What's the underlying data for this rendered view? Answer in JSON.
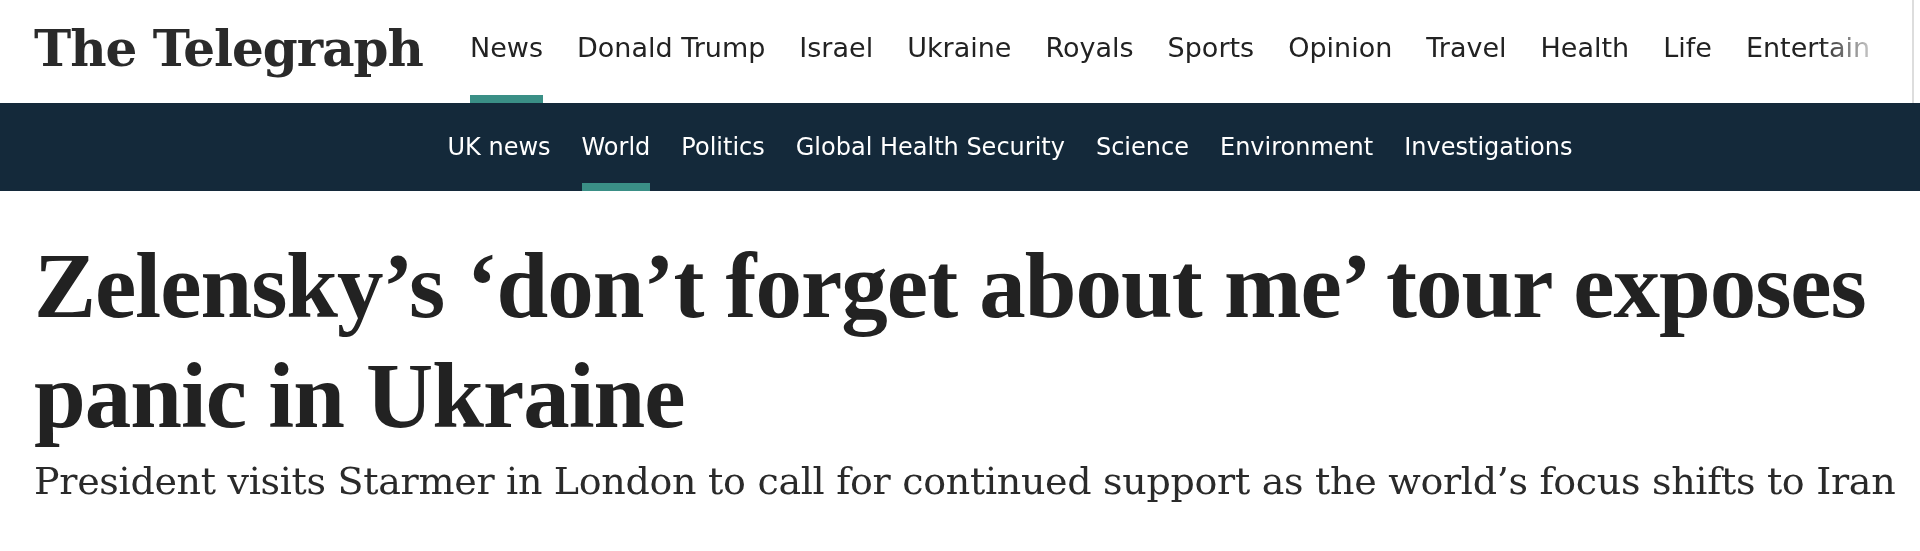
{
  "masthead": {
    "logo": "The Telegraph"
  },
  "primary_nav": [
    {
      "label": "News",
      "selected": true
    },
    {
      "label": "Donald Trump",
      "selected": false
    },
    {
      "label": "Israel",
      "selected": false
    },
    {
      "label": "Ukraine",
      "selected": false
    },
    {
      "label": "Royals",
      "selected": false
    },
    {
      "label": "Sports",
      "selected": false
    },
    {
      "label": "Opinion",
      "selected": false
    },
    {
      "label": "Travel",
      "selected": false
    },
    {
      "label": "Health",
      "selected": false
    },
    {
      "label": "Life",
      "selected": false
    },
    {
      "label": "Entertain",
      "selected": false
    }
  ],
  "secondary_nav": [
    {
      "label": "UK news",
      "selected": false
    },
    {
      "label": "World",
      "selected": true
    },
    {
      "label": "Politics",
      "selected": false
    },
    {
      "label": "Global Health Security",
      "selected": false
    },
    {
      "label": "Science",
      "selected": false
    },
    {
      "label": "Environment",
      "selected": false
    },
    {
      "label": "Investigations",
      "selected": false
    }
  ],
  "article": {
    "headline": "Zelensky’s ‘don’t forget about me’ tour exposes panic in Ukraine",
    "standfirst": "President visits Starmer in London to call for continued support as the world’s focus shifts to Iran"
  }
}
